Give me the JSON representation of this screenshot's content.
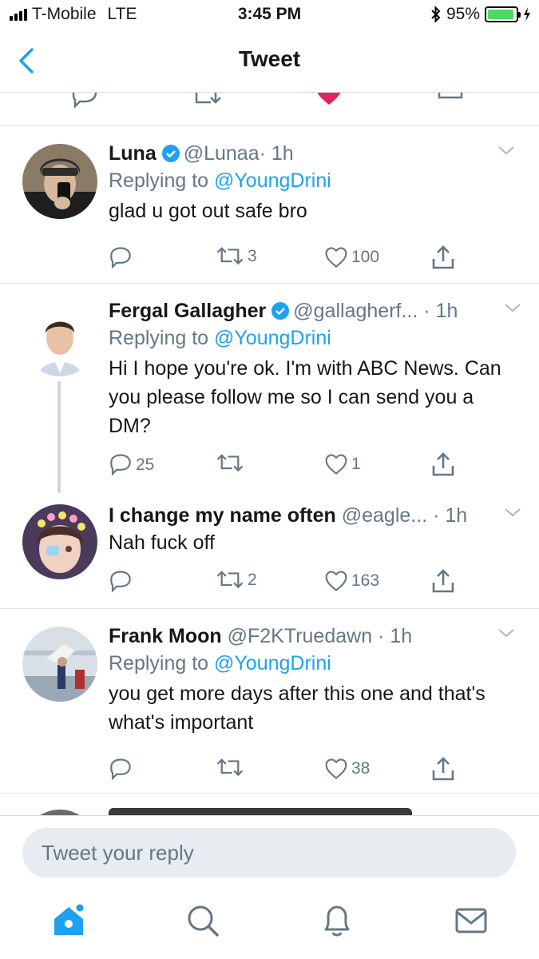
{
  "status_bar": {
    "carrier": "T-Mobile",
    "network": "LTE",
    "time": "3:45 PM",
    "battery_percent": "95%",
    "battery_level": 0.95
  },
  "nav": {
    "title": "Tweet"
  },
  "tweets": [
    {
      "name": "Luna",
      "verified": true,
      "handle": "@Lunaa",
      "time": "· 1h",
      "replying_prefix": "Replying to ",
      "replying_to": "@YoungDrini",
      "text": "glad u got out safe bro",
      "retweets": "3",
      "likes": "100"
    },
    {
      "name": "Fergal Gallagher",
      "verified": true,
      "handle": "@gallagherf...",
      "time": "· 1h",
      "replying_prefix": "Replying to ",
      "replying_to": "@YoungDrini",
      "text": "Hi I hope you're ok. I'm with ABC News. Can you please follow me so I can send you a DM?",
      "replies": "25",
      "likes": "1"
    },
    {
      "name": "I change my name often",
      "handle": "@eagle...",
      "time": "· 1h",
      "text": "Nah fuck off",
      "retweets": "2",
      "likes": "163"
    },
    {
      "name": "Frank Moon",
      "handle": "@F2KTruedawn",
      "time": "· 1h",
      "replying_prefix": "Replying to ",
      "replying_to": "@YoungDrini",
      "text": "you get more days after this one and that's what's important",
      "likes": "38"
    }
  ],
  "reply": {
    "placeholder": "Tweet your reply"
  },
  "tabs": [
    "home-icon",
    "search-icon",
    "notifications-bell-icon",
    "messages-envelope-icon"
  ],
  "colors": {
    "accent": "#1da1f2",
    "muted": "#657786",
    "like_red": "#e0245e",
    "divider": "#e1e8ed"
  }
}
